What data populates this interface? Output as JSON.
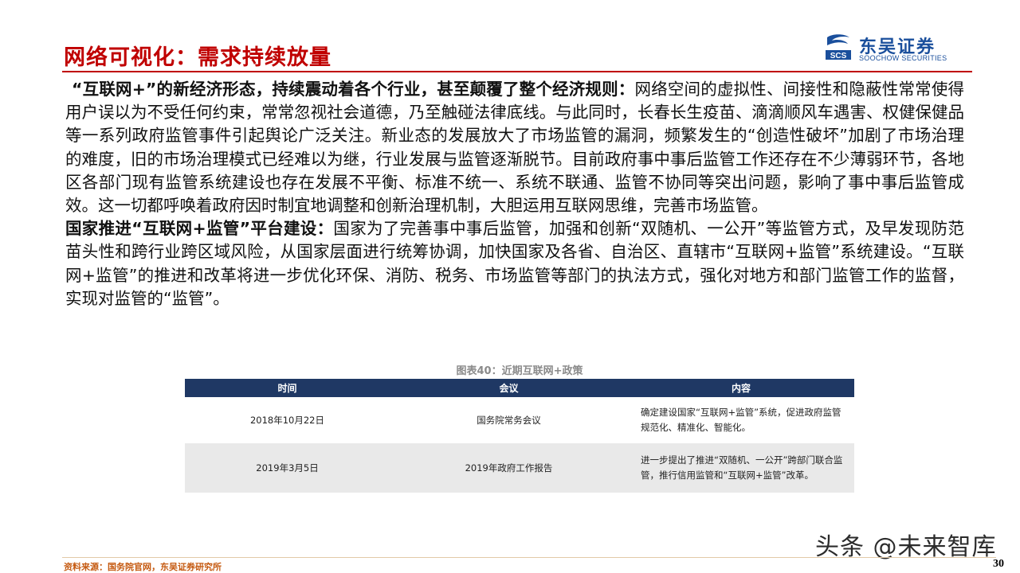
{
  "header": {
    "title": "网络可视化：需求持续放量"
  },
  "logo": {
    "brand_cn": "东吴证券",
    "brand_en": "SOOCHOW SECURITIES",
    "mark_letters": "SCS",
    "color": "#1a4f9c"
  },
  "body": {
    "para1_bold": "“互联网+”的新经济形态，持续震动着各个行业，甚至颠覆了整个经济规则：",
    "para1_text": "网络空间的虚拟性、间接性和隐蔽性常常使得用户误以为不受任何约束，常常忽视社会道德，乃至触碰法律底线。与此同时，长春长生疫苗、滴滴顺风车遇害、权健保健品等一系列政府监管事件引起舆论广泛关注。新业态的发展放大了市场监管的漏洞，频繁发生的“创造性破坏”加剧了市场治理的难度，旧的市场治理模式已经难以为继，行业发展与监管逐渐脱节。目前政府事中事后监管工作还存在不少薄弱环节，各地区各部门现有监管系统建设也存在发展不平衡、标准不统一、系统不联通、监管不协同等突出问题，影响了事中事后监管成效。这一切都呼唤着政府因时制宜地调整和创新治理机制，大胆运用互联网思维，完善市场监管。",
    "para2_bold": "国家推进“互联网+监管”平台建设：",
    "para2_text": "国家为了完善事中事后监管，加强和创新“双随机、一公开”等监管方式，及早发现防范苗头性和跨行业跨区域风险，从国家层面进行统筹协调，加快国家及各省、自治区、直辖市“互联网+监管”系统建设。“互联网+监管”的推进和改革将进一步优化环保、消防、税务、市场监管等部门的执法方式，强化对地方和部门监管工作的监督，实现对监管的“监管”。"
  },
  "table": {
    "caption": "图表40：近期互联网+政策",
    "headers": [
      "时间",
      "会议",
      "内容"
    ],
    "rows": [
      [
        "2018年10月22日",
        "国务院常务会议",
        "确定建设国家“互联网+监管”系统，促进政府监管规范化、精准化、智能化。"
      ],
      [
        "2019年3月5日",
        "2019年政府工作报告",
        "进一步提出了推进“双随机、一公开”跨部门联合监管，推行信用监管和“互联网+监管”改革。"
      ]
    ],
    "header_color": "#1f3864"
  },
  "footer": {
    "source": "资料来源：国务院官网，东吴证券研究所",
    "page_number": "30"
  },
  "watermark": {
    "text": "头条 @未来智库"
  },
  "colors": {
    "accent_red": "#c00000",
    "source_orange": "#c55a11"
  }
}
